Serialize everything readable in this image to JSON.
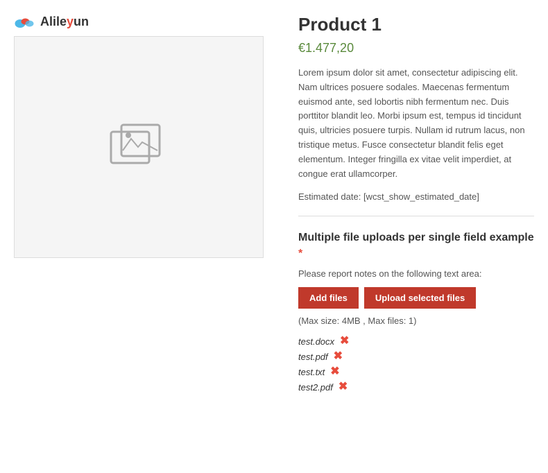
{
  "logo": {
    "text_before": "Alile",
    "text_highlight": "y",
    "text_after": "un"
  },
  "product": {
    "title": "Product 1",
    "price": "€1.477,20",
    "description": "Lorem ipsum dolor sit amet, consectetur adipiscing elit. Nam ultrices posuere sodales. Maecenas fermentum euismod ante, sed lobortis nibh fermentum nec. Duis porttitor blandit leo. Morbi ipsum est, tempus id tincidunt quis, ultricies posuere turpis. Nullam id rutrum lacus, non tristique metus. Fusce consectetur blandit felis eget elementum. Integer fringilla ex vitae velit imperdiet, at congue erat ullamcorper.",
    "estimated_date_label": "Estimated date: [wcst_show_estimated_date]"
  },
  "upload_section": {
    "title": "Multiple file uploads per single field example",
    "required_star": "*",
    "label": "Please report notes on the following text area:",
    "add_files_btn": "Add files",
    "upload_selected_btn": "Upload selected files",
    "max_info": "(Max size: 4MB , Max files: 1)",
    "files": [
      {
        "name": "test.docx"
      },
      {
        "name": "test.pdf"
      },
      {
        "name": "test.txt"
      },
      {
        "name": "test2.pdf"
      }
    ]
  }
}
